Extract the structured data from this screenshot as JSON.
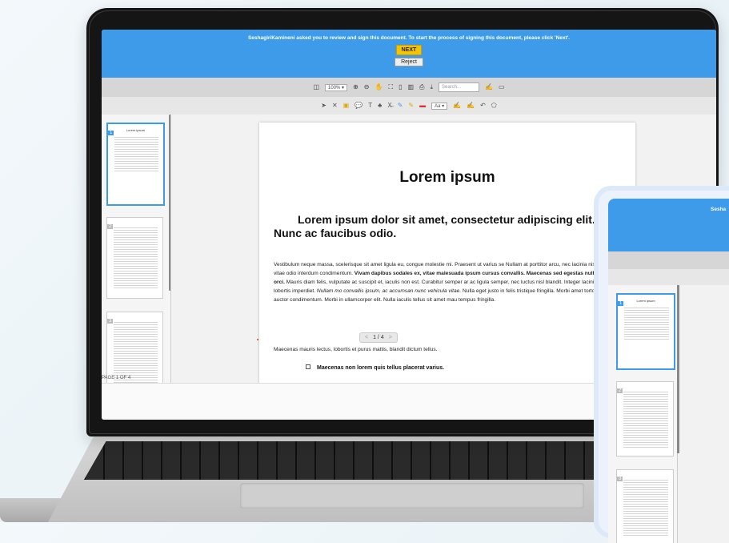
{
  "banner": {
    "message": "SeshagiriKamineni asked you to review and sign this document. To start the process of signing this document, please click 'Next'.",
    "next_label": "NEXT",
    "reject_label": "Reject"
  },
  "toolbar": {
    "zoom": "100%",
    "search_placeholder": "Search...",
    "font_size_label": "Aa"
  },
  "sidebar": {
    "thumbnails": [
      {
        "number": "1",
        "title": "Lorem ipsum"
      },
      {
        "number": "2"
      },
      {
        "number": "3"
      }
    ],
    "page_indicator": "PAGE 1 OF 4"
  },
  "document": {
    "title": "Lorem ipsum",
    "subtitle": "Lorem ipsum dolor sit amet, consectetur adipiscing elit. Nunc ac faucibus odio.",
    "para1_a": "Vestibulum neque massa, scelerisque sit amet ligula eu, congue molestie mi. Praesent ut varius se Nullam at porttitor arcu, nec lacinia nisi. Ut ac dolor vitae odio interdum condimentum. ",
    "para1_b": "Vivam dapibus sodales ex, vitae malesuada ipsum cursus convallis. Maecenas sed egestas nulla, condimentum orci.",
    "para1_c": " Mauris diam felis, vulputate ac suscipit et, iaculis non est. Curabitur semper ar ac ligula semper, nec luctus nisl blandit. Integer lacinia ante ac libero lobortis imperdiet. ",
    "para1_d": "Nullam mo convallis ipsum, ac accumsan nunc vehicula vitae.",
    "para1_e": " Nulla eget justo in felis tristique fringilla. Morbi amet tortor quis risus auctor condimentum. Morbi in ullamcorper elit. Nulla iaculis tellus sit amet mau tempus fringilla.",
    "para2": "Maecenas mauris lectus, lobortis et purus mattis, blandit dictum tellus.",
    "bullet": "Maecenas non lorem quis tellus placerat varius."
  },
  "pager": {
    "prev": "<",
    "label": "1 / 4",
    "next": ">"
  },
  "tablet": {
    "banner_fragment": "Sesha"
  },
  "colors": {
    "accent": "#3d9be9",
    "next_button": "#f5c400"
  }
}
